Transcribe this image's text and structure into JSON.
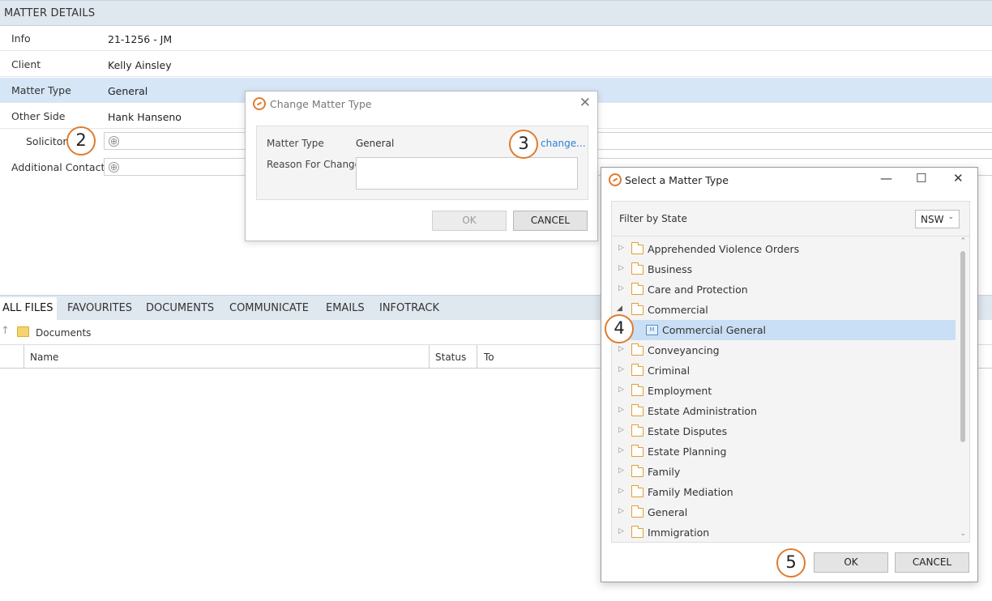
{
  "matter_details": {
    "header": "MATTER DETAILS",
    "rows": [
      {
        "label": "Info",
        "value": "21-1256 - JM"
      },
      {
        "label": "Client",
        "value": "Kelly Ainsley"
      },
      {
        "label": "Matter Type",
        "value": "General"
      },
      {
        "label": "Other Side",
        "value": "Hank Hanseno"
      },
      {
        "label": "Solicitor",
        "value": ""
      },
      {
        "label": "Additional Contact",
        "value": ""
      }
    ]
  },
  "steps": [
    "2",
    "3",
    "4",
    "5"
  ],
  "icons": {
    "plus": "⊕",
    "up_arrow": "↑",
    "close": "✕",
    "minimize": "—",
    "maximize": "☐",
    "dropdown": "⌄",
    "expand": "▷",
    "collapse": "◢",
    "scroll_up": "⌃",
    "scroll_down": "⌄"
  },
  "tabs": [
    "ALL FILES",
    "FAVOURITES",
    "DOCUMENTS",
    "COMMUNICATE",
    "EMAILS",
    "INFOTRACK"
  ],
  "breadcrumb": "Documents",
  "grid_columns": [
    "Name",
    "Status",
    "To"
  ],
  "change_dialog": {
    "title": "Change Matter Type",
    "matter_type_label": "Matter Type",
    "matter_type_value": "General",
    "change_link": "change...",
    "reason_label": "Reason For Change",
    "ok": "OK",
    "cancel": "CANCEL"
  },
  "select_dialog": {
    "title": "Select a Matter Type",
    "filter_label": "Filter by State",
    "filter_value": "NSW",
    "tree": [
      {
        "label": "Apprehended Violence Orders",
        "level": 0,
        "state": "collapsed"
      },
      {
        "label": "Business",
        "level": 0,
        "state": "collapsed"
      },
      {
        "label": "Care and Protection",
        "level": 0,
        "state": "collapsed"
      },
      {
        "label": "Commercial",
        "level": 0,
        "state": "expanded"
      },
      {
        "label": "Commercial General",
        "level": 1,
        "state": "leaf",
        "selected": true
      },
      {
        "label": "Conveyancing",
        "level": 0,
        "state": "collapsed"
      },
      {
        "label": "Criminal",
        "level": 0,
        "state": "collapsed"
      },
      {
        "label": "Employment",
        "level": 0,
        "state": "collapsed"
      },
      {
        "label": "Estate Administration",
        "level": 0,
        "state": "collapsed"
      },
      {
        "label": "Estate Disputes",
        "level": 0,
        "state": "collapsed"
      },
      {
        "label": "Estate Planning",
        "level": 0,
        "state": "collapsed"
      },
      {
        "label": "Family",
        "level": 0,
        "state": "collapsed"
      },
      {
        "label": "Family Mediation",
        "level": 0,
        "state": "collapsed"
      },
      {
        "label": "General",
        "level": 0,
        "state": "collapsed"
      },
      {
        "label": "Immigration",
        "level": 0,
        "state": "collapsed"
      }
    ],
    "ok": "OK",
    "cancel": "CANCEL"
  },
  "colors": {
    "accent": "#e07b2e",
    "link": "#2f7fd1",
    "selection": "#c9dff5",
    "header_bg": "#dfe7ef"
  }
}
